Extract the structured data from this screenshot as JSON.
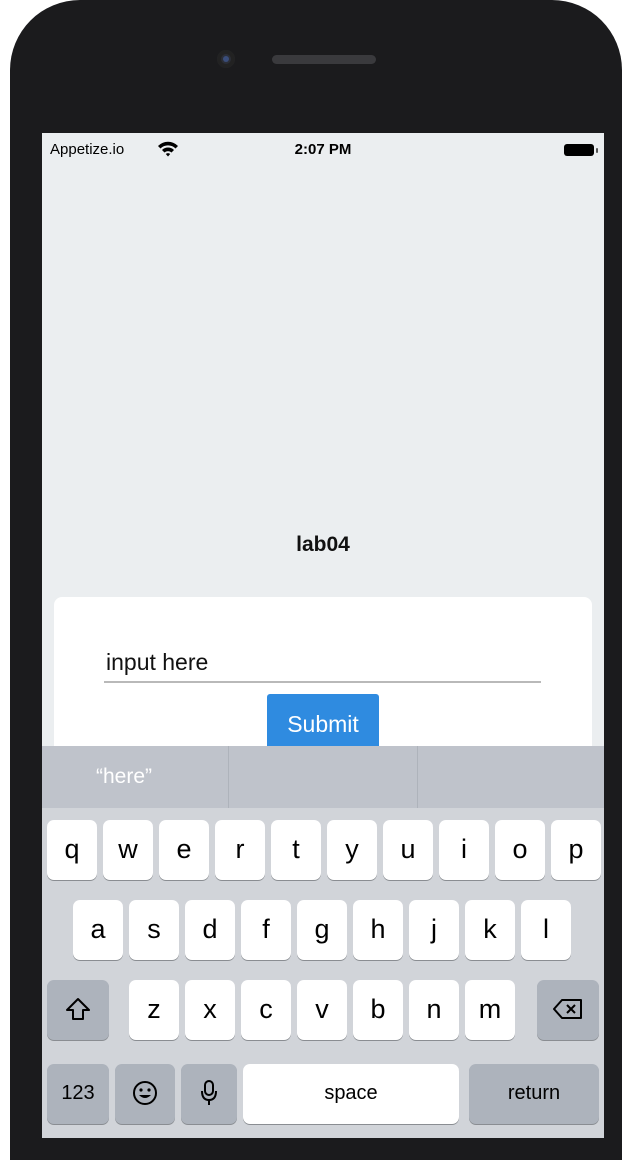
{
  "status_bar": {
    "carrier": "Appetize.io",
    "time": "2:07 PM",
    "wifi_icon": "wifi-icon",
    "battery_icon": "battery-icon"
  },
  "app": {
    "title": "lab04",
    "input_value": "input here",
    "submit_label": "Submit"
  },
  "keyboard": {
    "suggestions": [
      "“here”",
      "",
      ""
    ],
    "row1": [
      "q",
      "w",
      "e",
      "r",
      "t",
      "y",
      "u",
      "i",
      "o",
      "p"
    ],
    "row2": [
      "a",
      "s",
      "d",
      "f",
      "g",
      "h",
      "j",
      "k",
      "l"
    ],
    "row3": [
      "z",
      "x",
      "c",
      "v",
      "b",
      "n",
      "m"
    ],
    "shift_icon": "shift-icon",
    "backspace_icon": "backspace-icon",
    "numbers_label": "123",
    "emoji_icon": "emoji-icon",
    "mic_icon": "microphone-icon",
    "space_label": "space",
    "return_label": "return"
  },
  "colors": {
    "screen_bg": "#ebeef0",
    "submit_bg": "#2f8be0",
    "keyboard_bg": "#d1d4d9",
    "phone_frame": "#1b1b1d"
  }
}
